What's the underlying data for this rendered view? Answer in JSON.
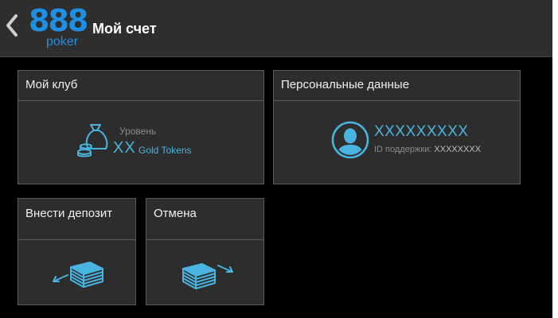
{
  "header": {
    "title": "Мой счет",
    "logo_number": "888",
    "logo_word": "poker"
  },
  "cards": {
    "club": {
      "title": "Мой клуб",
      "level_label": "Уровень",
      "level_value": "XX",
      "level_unit": "Gold Tokens"
    },
    "personal": {
      "title": "Персональные данные",
      "name": "XXXXXXXXX",
      "support_label": "ID поддержки:",
      "support_id": "XXXXXXXX"
    },
    "deposit": {
      "title": "Внести депозит"
    },
    "cancel": {
      "title": "Отмена"
    }
  },
  "icons": {
    "back": "chevron-left-icon",
    "club": "money-bag-coins-icon",
    "personal": "user-avatar-icon",
    "deposit": "cash-stack-arrow-in-icon",
    "cancel": "cash-stack-arrow-out-icon"
  },
  "colors": {
    "accent": "#4ab4e0",
    "brand": "#1f8fe3",
    "card_bg": "#2d2d2d",
    "header_bg": "#2e2e2e",
    "border": "#5a5a5a"
  }
}
